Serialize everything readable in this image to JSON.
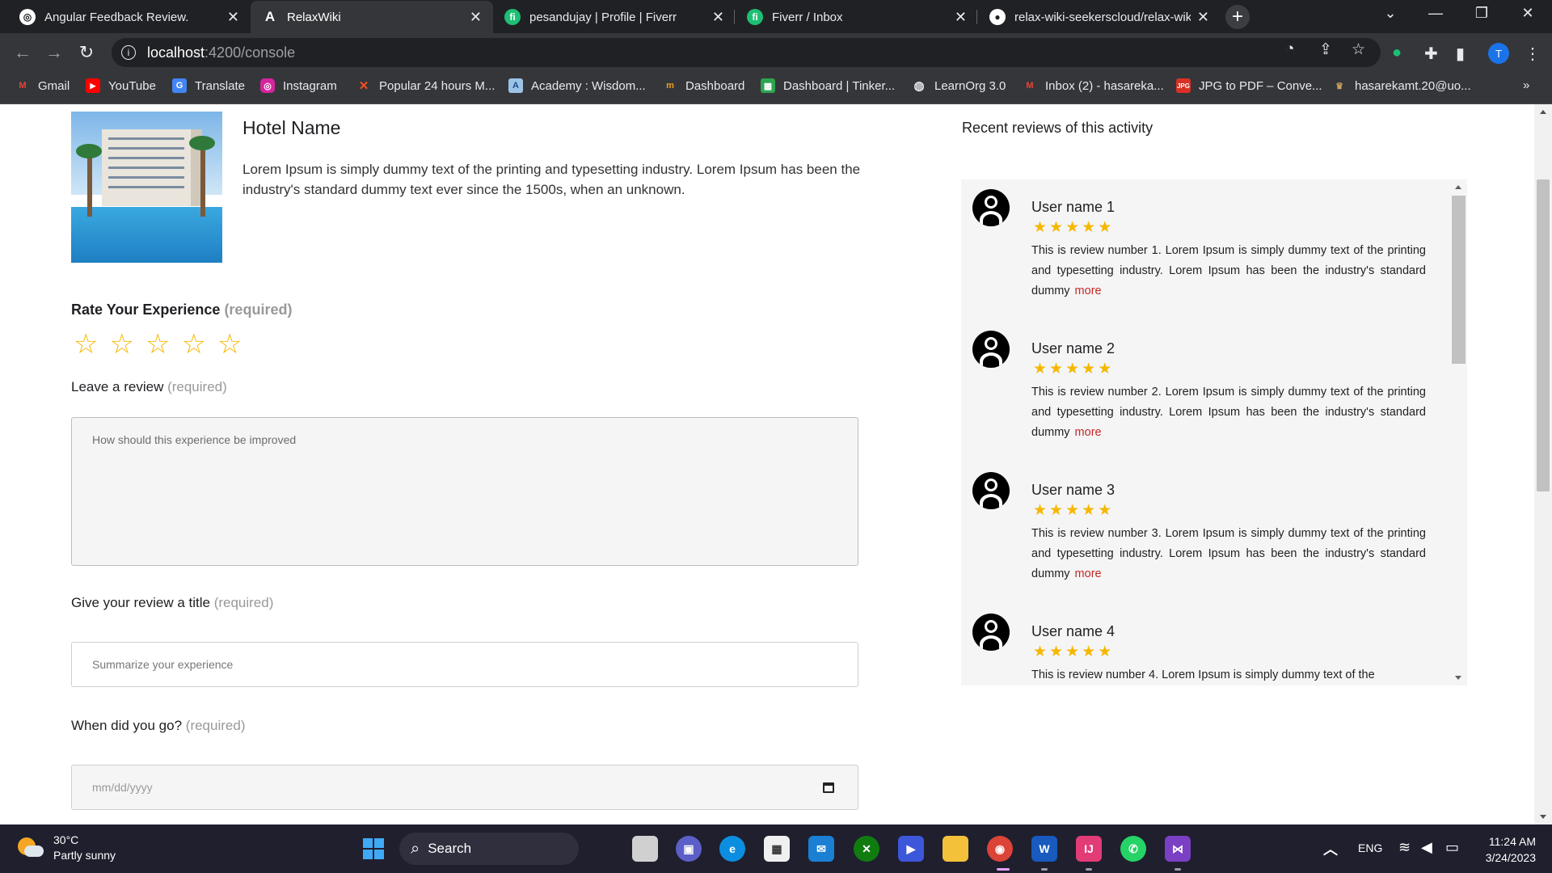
{
  "browser": {
    "tabs": [
      {
        "label": "Angular Feedback Review.",
        "icon": "chatgpt-icon",
        "active": false
      },
      {
        "label": "RelaxWiki",
        "icon": "angular-icon",
        "active": true
      },
      {
        "label": "pesandujay | Profile | Fiverr",
        "icon": "fiverr-icon",
        "active": false
      },
      {
        "label": "Fiverr / Inbox",
        "icon": "fiverr-icon",
        "active": false
      },
      {
        "label": "relax-wiki-seekerscloud/relax-wik",
        "icon": "github-icon",
        "active": false
      }
    ],
    "url_host": "localhost",
    "url_path": ":4200/console",
    "profile_initial": "T",
    "bookmarks": [
      {
        "label": "Gmail",
        "icon": "gmail-icon"
      },
      {
        "label": "YouTube",
        "icon": "youtube-icon"
      },
      {
        "label": "Translate",
        "icon": "translate-icon"
      },
      {
        "label": "Instagram",
        "icon": "instagram-icon"
      },
      {
        "label": "Popular 24 hours M...",
        "icon": "x-icon"
      },
      {
        "label": "Academy : Wisdom...",
        "icon": "academy-icon"
      },
      {
        "label": "Dashboard",
        "icon": "dashboard-icon"
      },
      {
        "label": "Dashboard | Tinker...",
        "icon": "tinkercad-icon"
      },
      {
        "label": "LearnOrg 3.0",
        "icon": "globe-icon"
      },
      {
        "label": "Inbox (2) - hasareka...",
        "icon": "gmail-icon"
      },
      {
        "label": "JPG to PDF – Conve...",
        "icon": "jpg-pdf-icon"
      },
      {
        "label": "hasarekamt.20@uo...",
        "icon": "bookmark-icon"
      }
    ]
  },
  "hotel": {
    "name": "Hotel Name",
    "description": "Lorem Ipsum is simply dummy text of the printing and typesetting industry. Lorem Ipsum has been the industry's standard dummy text ever since the 1500s, when an unknown."
  },
  "form": {
    "rate_label": "Rate Your Experience",
    "rate_required": "(required)",
    "review_label": "Leave a review",
    "review_required": "(required)",
    "review_placeholder": "How should this experience be improved",
    "title_label": "Give your review a title",
    "title_required": "(required)",
    "title_placeholder": "Summarize your experience",
    "date_label": "When did you go?",
    "date_required": "(required)",
    "date_placeholder": "mm/dd/yyyy"
  },
  "recent": {
    "title": "Recent reviews of this activity",
    "more_label": "more",
    "reviews": [
      {
        "user": "User name 1",
        "rating": 5,
        "text": "This is review number 1. Lorem Ipsum is simply dummy text of the printing and typesetting industry. Lorem Ipsum has been the industry's standard dummy"
      },
      {
        "user": "User name 2",
        "rating": 5,
        "text": "This is review number 2. Lorem Ipsum is simply dummy text of the printing and typesetting industry. Lorem Ipsum has been the industry's standard dummy"
      },
      {
        "user": "User name 3",
        "rating": 5,
        "text": "This is review number 3. Lorem Ipsum is simply dummy text of the printing and typesetting industry. Lorem Ipsum has been the industry's standard dummy"
      },
      {
        "user": "User name 4",
        "rating": 5,
        "text": "This is review number 4. Lorem Ipsum is simply dummy text of the"
      }
    ]
  },
  "taskbar": {
    "temperature": "30°C",
    "weather": "Partly sunny",
    "search_label": "Search",
    "language": "ENG",
    "time": "11:24 AM",
    "date": "3/24/2023"
  },
  "colors": {
    "star": "#f5b700",
    "more_link": "#c62828",
    "panel_bg": "#f5f5f5"
  }
}
